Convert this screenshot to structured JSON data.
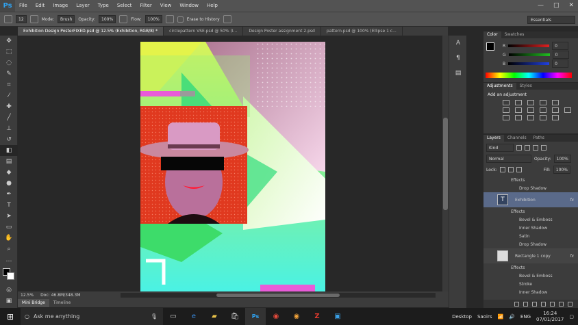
{
  "app": {
    "logo": "Ps"
  },
  "menu": [
    "File",
    "Edit",
    "Image",
    "Layer",
    "Type",
    "Select",
    "Filter",
    "View",
    "Window",
    "Help"
  ],
  "window_controls": {
    "minimize": "—",
    "maximize": "□",
    "close": "✕"
  },
  "options_bar": {
    "brush_size": "12",
    "mode_label": "Mode:",
    "mode_value": "Brush",
    "opacity_label": "Opacity:",
    "opacity_value": "100%",
    "flow_label": "Flow:",
    "flow_value": "100%",
    "erase_history": "Erase to History",
    "workspace": "Essentials"
  },
  "tabs": [
    "Exhibition Design PosterFIXED.psd @ 12.5% (Exhibition, RGB/8) *",
    "circlepattern VSE.psd @ 50% (I...",
    "Design Poster assignment 2.psd",
    "pattern.psd @ 100% (Ellipse 1 c..."
  ],
  "status": {
    "zoom": "12.5%",
    "doc": "Doc: 46.8M/348.3M"
  },
  "bottom_tabs": [
    "Mini Bridge",
    "Timeline"
  ],
  "color_panel": {
    "tabs": [
      "Color",
      "Swatches"
    ],
    "channels": [
      {
        "label": "R",
        "value": "0"
      },
      {
        "label": "G",
        "value": "0"
      },
      {
        "label": "B",
        "value": "0"
      }
    ]
  },
  "adjustments_panel": {
    "tabs": [
      "Adjustments",
      "Styles"
    ],
    "heading": "Add an adjustment"
  },
  "layers_panel": {
    "tabs": [
      "Layers",
      "Channels",
      "Paths"
    ],
    "kind": "Kind",
    "blend": "Normal",
    "opacity_label": "Opacity:",
    "opacity_value": "100%",
    "lock_label": "Lock:",
    "fill_label": "Fill:",
    "fill_value": "100%",
    "rows": [
      {
        "label": "Effects"
      },
      {
        "label": "Drop Shadow"
      },
      {
        "label": "Exhibition",
        "fx": "fx"
      },
      {
        "label": "Effects"
      },
      {
        "label": "Bevel & Emboss"
      },
      {
        "label": "Inner Shadow"
      },
      {
        "label": "Satin"
      },
      {
        "label": "Drop Shadow"
      },
      {
        "label": "Rectangle 1 copy",
        "fx": "fx"
      },
      {
        "label": "Effects"
      },
      {
        "label": "Bevel & Emboss"
      },
      {
        "label": "Stroke"
      },
      {
        "label": "Inner Shadow"
      }
    ]
  },
  "taskbar": {
    "search_placeholder": "Ask me anything",
    "desktop_label": "Desktop",
    "user": "Saoirs",
    "lang": "ENG",
    "time": "16:24",
    "date": "07/01/2017"
  }
}
